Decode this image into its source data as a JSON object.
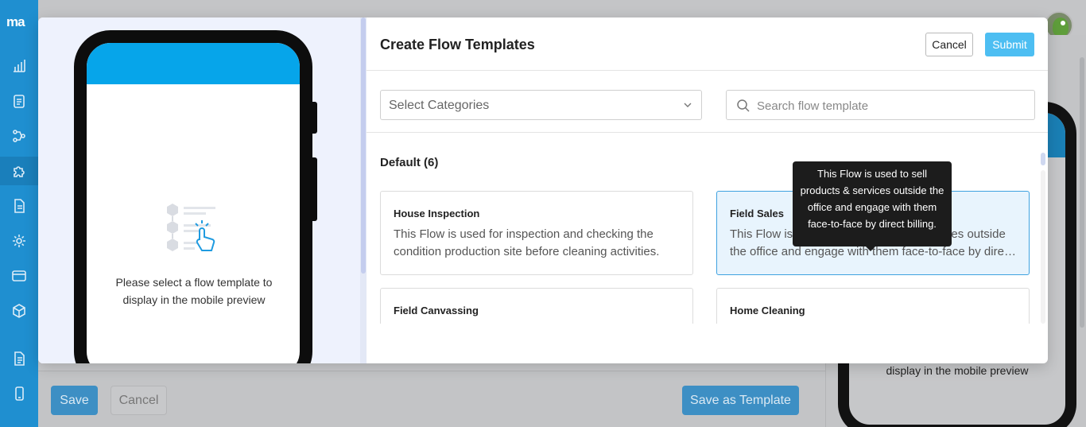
{
  "app": {
    "logo": "ma"
  },
  "rail": {
    "items": [
      {
        "icon": "bar-chart-icon"
      },
      {
        "icon": "clipboard-icon"
      },
      {
        "icon": "flow-icon"
      },
      {
        "icon": "puzzle-icon"
      },
      {
        "icon": "document-icon"
      },
      {
        "icon": "settings-icon"
      },
      {
        "icon": "card-icon"
      },
      {
        "icon": "box-icon"
      },
      {
        "icon": "file-text-icon"
      },
      {
        "icon": "phone-icon"
      }
    ]
  },
  "background": {
    "save_label": "Save",
    "cancel_label": "Cancel",
    "save_template_label": "Save as Template",
    "preview_text": "display in the mobile preview"
  },
  "modal": {
    "title": "Create Flow Templates",
    "cancel_label": "Cancel",
    "submit_label": "Submit",
    "preview_text": "Please select a flow template to display in the mobile preview",
    "category_select": {
      "placeholder": "Select Categories"
    },
    "search": {
      "placeholder": "Search flow template",
      "value": ""
    },
    "section": {
      "title": "Default (6)"
    },
    "cards": [
      {
        "title": "House Inspection",
        "description": "This Flow is used for inspection and checking the condition production site before cleaning activities."
      },
      {
        "title": "Field Sales",
        "description": "This Flow is used to sell products & services outside the office and engage with them face-to-face by direct billing.",
        "selected": true
      },
      {
        "title": "Field Canvassing",
        "description": ""
      },
      {
        "title": "Home Cleaning",
        "description": ""
      }
    ],
    "tooltip": "This Flow is used to sell products & services outside the office and engage with them face-to-face by direct billing."
  },
  "colors": {
    "rail": "#1f8fd0",
    "accent": "#06a5ea",
    "submit": "#4dbef2",
    "selected_card": "#e8f4fd"
  }
}
